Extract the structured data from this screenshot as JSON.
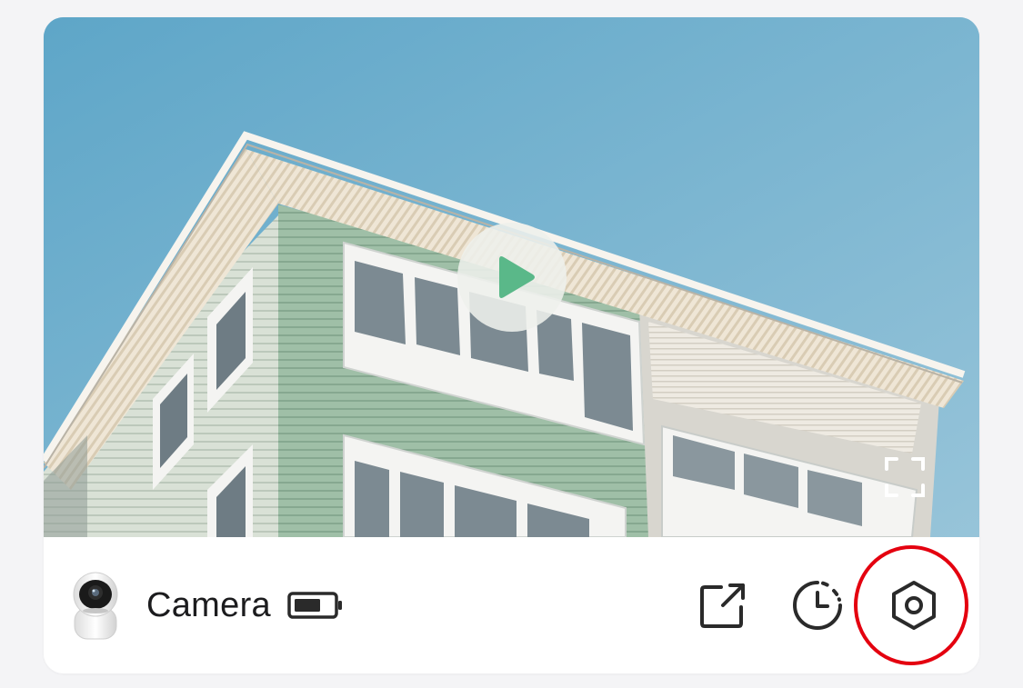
{
  "device": {
    "name": "Camera",
    "battery_level_percent": 60,
    "thumbnail_icon": "security-camera-icon"
  },
  "preview": {
    "play_icon": "play-icon",
    "fullscreen_icon": "fullscreen-icon",
    "image_subject": "apartment-building-exterior"
  },
  "actions": {
    "share_icon": "share-external-icon",
    "history_icon": "clock-history-icon",
    "settings_icon": "settings-hexagon-icon",
    "settings_highlighted": true
  },
  "colors": {
    "play_accent": "#5ab889",
    "highlight": "#e4000f",
    "text": "#1c1c1e",
    "icon_stroke": "#2a2a2a"
  }
}
